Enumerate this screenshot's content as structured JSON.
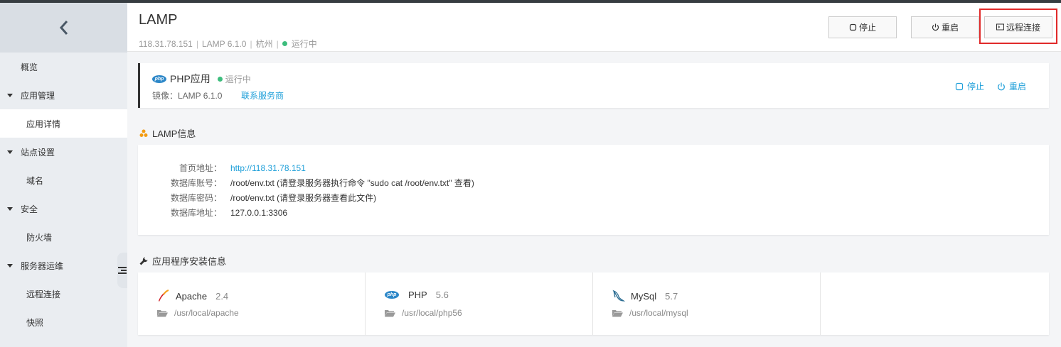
{
  "header": {
    "title": "LAMP",
    "ip": "118.31.78.151",
    "app": "LAMP  6.1.0",
    "region": "杭州",
    "status": "运行中",
    "stop_label": "停止",
    "restart_label": "重启",
    "remote_label": "远程连接"
  },
  "sidebar": {
    "items": [
      {
        "label": "概览"
      },
      {
        "label": "应用管理"
      },
      {
        "label": "应用详情"
      },
      {
        "label": "站点设置"
      },
      {
        "label": "域名"
      },
      {
        "label": "安全"
      },
      {
        "label": "防火墙"
      },
      {
        "label": "服务器运维"
      },
      {
        "label": "远程连接"
      },
      {
        "label": "快照"
      }
    ]
  },
  "app_card": {
    "name": "PHP应用",
    "status": "运行中",
    "image": "镜像：LAMP 6.1.0",
    "link": "联系服务商",
    "stop_label": "停止",
    "restart_label": "重启",
    "badge": "php"
  },
  "lamp_info": {
    "title": "LAMP信息",
    "rows": [
      {
        "label": "首页地址：",
        "value": "http://118.31.78.151"
      },
      {
        "label": "数据库账号：",
        "value": "/root/env.txt (请登录服务器执行命令 \"sudo cat /root/env.txt\" 查看)"
      },
      {
        "label": "数据库密码：",
        "value": "/root/env.txt (请登录服务器查看此文件)"
      },
      {
        "label": "数据库地址：",
        "value": "127.0.0.1:3306"
      }
    ]
  },
  "install_info": {
    "title": "应用程序安装信息",
    "items": [
      {
        "name": "Apache",
        "version": "2.4",
        "path": "/usr/local/apache"
      },
      {
        "name": "PHP",
        "version": "5.6",
        "path": "/usr/local/php56"
      },
      {
        "name": "MySql",
        "version": "5.7",
        "path": "/usr/local/mysql"
      }
    ]
  },
  "colors": {
    "accent": "#1e9fd9",
    "running": "#3dbd7d",
    "highlight": "#e02a2a"
  }
}
